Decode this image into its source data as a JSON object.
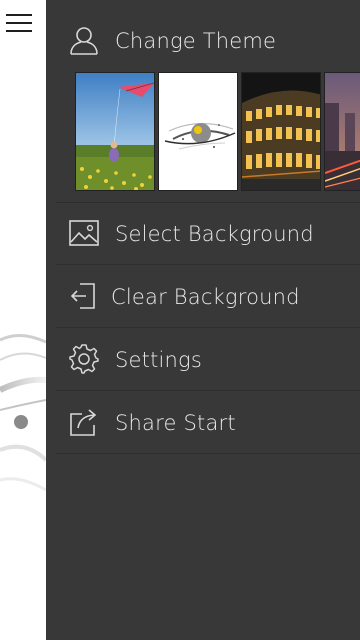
{
  "app": {
    "menu_button": "menu"
  },
  "drawer": {
    "change_theme": {
      "label": "Change Theme",
      "icon": "user-icon"
    },
    "themes": [
      {
        "name": "kite",
        "icon": "kite-thumbnail"
      },
      {
        "name": "planet",
        "icon": "planet-thumbnail"
      },
      {
        "name": "colosseum",
        "icon": "colosseum-thumbnail"
      },
      {
        "name": "street",
        "icon": "street-thumbnail"
      }
    ],
    "items": [
      {
        "label": "Select Background",
        "icon": "image-icon"
      },
      {
        "label": "Clear Background",
        "icon": "clear-icon"
      },
      {
        "label": "Settings",
        "icon": "gear-icon"
      },
      {
        "label": "Share Start",
        "icon": "share-icon"
      }
    ]
  },
  "colors": {
    "drawer_bg": "#383838",
    "text": "#e8e8e8",
    "divider": "#2c2c2c"
  }
}
